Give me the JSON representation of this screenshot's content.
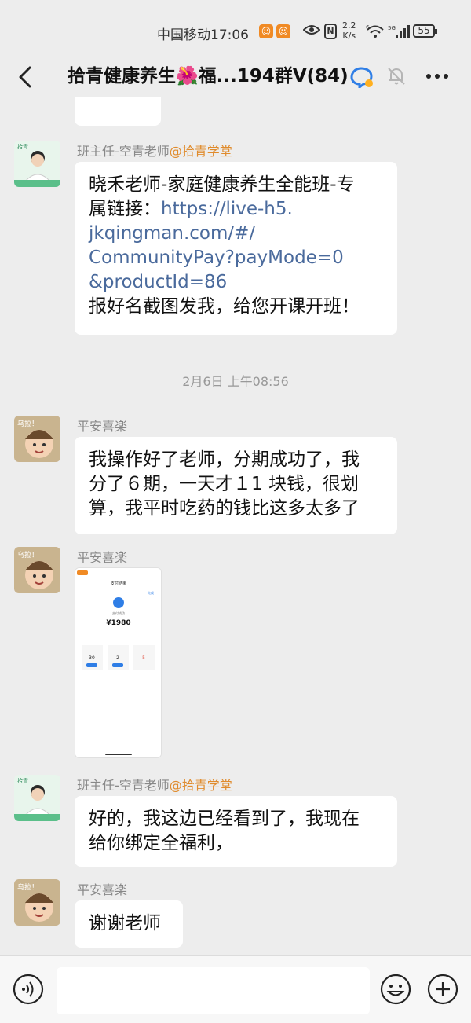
{
  "status_bar": {
    "carrier_time": "中国移动17:06",
    "speed_value": "2.2",
    "speed_unit": "K/s",
    "wifi_sup": "6",
    "signal_label": "5G",
    "battery": "55",
    "icons": [
      "app-badge-icon",
      "app-badge-icon",
      "eye-icon",
      "nfc-icon",
      "wifi-icon",
      "signal-icon",
      "battery-icon"
    ]
  },
  "header": {
    "title": "拾青健康养生🌺福...194群V(84)",
    "icons": [
      "back-arrow-icon",
      "group-badge-icon",
      "mute-bell-icon",
      "more-dots-icon"
    ]
  },
  "messages": [
    {
      "sender_name": "班主任-空青老师",
      "sender_org": "@拾青学堂",
      "lines": [
        "晓禾老师-家庭健康养生全能班-专",
        "属链接："
      ],
      "link_lines": [
        "https://live-h5.",
        "jkqingman.com/#/",
        "CommunityPay?payMode=0",
        "&productId=86"
      ],
      "link_inline": "https://live-h5.",
      "tail": "报好名截图发我，给您开课开班！"
    },
    {
      "timestamp": "2月6日 上午08:56"
    },
    {
      "sender_name": "平安喜楽",
      "lines": [
        "我操作好了老师，分期成功了，我",
        "分了６期，一天才１1 块钱，很划",
        "算，我平时吃药的钱比这多太多了"
      ]
    },
    {
      "sender_name": "平安喜楽",
      "image": {
        "title": "支付结果",
        "done": "完成",
        "status": "支付成功",
        "amount": "¥1980",
        "stats": [
          "30",
          "2",
          "5"
        ]
      }
    },
    {
      "sender_name": "班主任-空青老师",
      "sender_org": "@拾青学堂",
      "lines": [
        "好的，我这边已经看到了，我现在",
        "给你绑定全福利，"
      ]
    },
    {
      "sender_name": "平安喜楽",
      "lines": [
        "谢谢老师"
      ]
    }
  ],
  "avatar_text": {
    "teacher_tag": "拾青",
    "kid_tag": "乌拉！"
  },
  "input_bar": {
    "placeholder": "",
    "icons": [
      "voice-icon",
      "emoji-icon",
      "plus-icon"
    ]
  },
  "colors": {
    "background": "#ededed",
    "bubble": "#ffffff",
    "link": "#4a6a9c",
    "org": "#e08b2c"
  }
}
